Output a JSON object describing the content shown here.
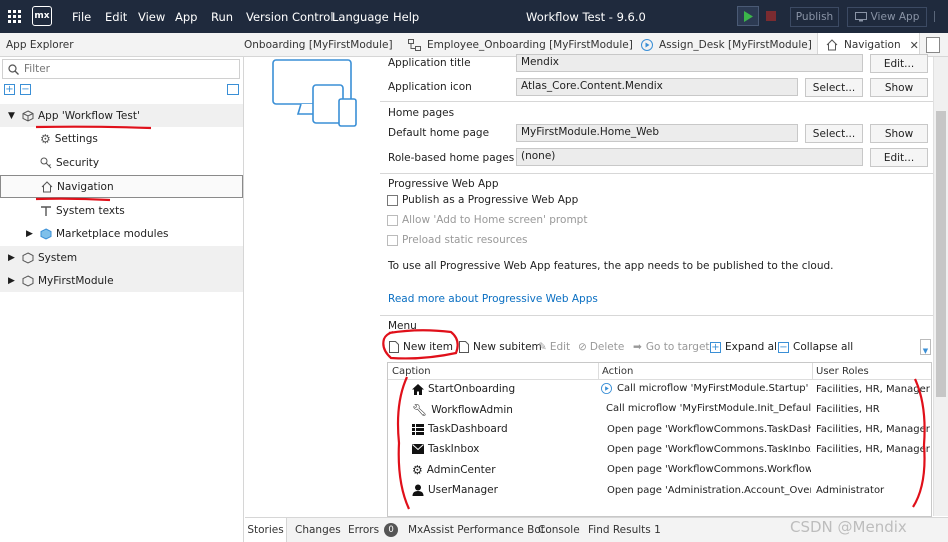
{
  "titlebar": {
    "logo": "mx",
    "menus": [
      "File",
      "Edit",
      "View",
      "App",
      "Run",
      "Version Control",
      "Language",
      "Help"
    ],
    "window_title": "Workflow Test  -  9.6.0",
    "publish_label": "Publish",
    "view_app_label": "View App"
  },
  "explorer": {
    "title": "App Explorer",
    "filter_placeholder": "Filter",
    "items": {
      "app": "App 'Workflow Test'",
      "settings": "Settings",
      "security": "Security",
      "navigation": "Navigation",
      "system_texts": "System texts",
      "marketplace": "Marketplace modules",
      "system": "System",
      "myfirstmodule": "MyFirstModule"
    }
  },
  "tabs": [
    {
      "label": "Onboarding [MyFirstModule]"
    },
    {
      "label": "Employee_Onboarding [MyFirstModule]"
    },
    {
      "label": "Assign_Desk [MyFirstModule]"
    },
    {
      "label": "Navigation"
    }
  ],
  "app_settings": {
    "application_title_label": "Application title",
    "application_title_value": "Mendix",
    "application_icon_label": "Application icon",
    "application_icon_value": "Atlas_Core.Content.Mendix",
    "edit_label": "Edit...",
    "select_label": "Select...",
    "show_label": "Show"
  },
  "home_pages": {
    "heading": "Home pages",
    "default_label": "Default home page",
    "default_value": "MyFirstModule.Home_Web",
    "role_based_label": "Role-based home pages",
    "role_based_value": "(none)"
  },
  "pwa": {
    "heading": "Progressive Web App",
    "publish_label": "Publish as a Progressive Web App",
    "allow_label": "Allow 'Add to Home screen' prompt",
    "preload_label": "Preload static resources",
    "info_text": "To use all Progressive Web App features, the app needs to be published to the cloud.",
    "link_text": "Read more about Progressive Web Apps"
  },
  "menu": {
    "heading": "Menu",
    "toolbar": {
      "new_item": "New item",
      "new_subitem": "New subitem",
      "edit": "Edit",
      "delete": "Delete",
      "go_to_target": "Go to target",
      "expand_all": "Expand all",
      "collapse_all": "Collapse all"
    },
    "columns": [
      "Caption",
      "Action",
      "User Roles"
    ],
    "rows": [
      {
        "icon": "home-icon",
        "caption": "StartOnboarding",
        "action_icon": "play-icon",
        "action": "Call microflow 'MyFirstModule.Startup'",
        "roles": "Facilities, HR, Manager"
      },
      {
        "icon": "wrench-icon",
        "caption": "WorkflowAdmin",
        "action_icon": "play-icon",
        "action": "Call microflow 'MyFirstModule.Init_Default...",
        "roles": "Facilities, HR"
      },
      {
        "icon": "list-icon",
        "caption": "TaskDashboard",
        "action_icon": "page-icon",
        "action": "Open page 'WorkflowCommons.TaskDashb...",
        "roles": "Facilities, HR, Manager"
      },
      {
        "icon": "envelope-icon",
        "caption": "TaskInbox",
        "action_icon": "page-icon",
        "action": "Open page 'WorkflowCommons.TaskInbox'",
        "roles": "Facilities, HR, Manager"
      },
      {
        "icon": "gear-icon",
        "caption": "AdminCenter",
        "action_icon": "page-icon",
        "action": "Open page 'WorkflowCommons.WorkflowA...",
        "roles": ""
      },
      {
        "icon": "user-icon",
        "caption": "UserManager",
        "action_icon": "page-icon",
        "action": "Open page 'Administration.Account_Overvi...",
        "roles": "Administrator"
      }
    ]
  },
  "bottom_tabs": {
    "stories": "Stories",
    "changes": "Changes",
    "errors": "Errors",
    "errors_count": "0",
    "mxassist": "MxAssist Performance Bot",
    "console": "Console",
    "find_results": "Find Results 1"
  },
  "watermark": "CSDN @Mendix",
  "colors": {
    "titlebar": "#1f2a3d",
    "accent": "#0a6fc2",
    "annotation": "#e0101a",
    "run": "#3bb54a"
  }
}
